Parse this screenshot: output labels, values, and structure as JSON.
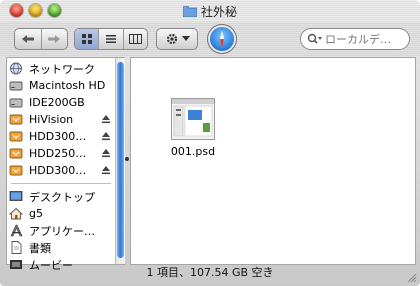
{
  "window": {
    "title": "社外秘",
    "title_icon": "folder-icon"
  },
  "toolbar": {
    "back_icon": "back-arrow-icon",
    "forward_icon": "forward-arrow-icon",
    "view_buttons": [
      "icon-view",
      "list-view",
      "column-view"
    ],
    "active_view": "icon-view",
    "action_icon": "gear-icon",
    "browser_icon": "safari-icon",
    "search_placeholder": "ローカルデ…"
  },
  "sidebar": {
    "devices": [
      {
        "label": "ネットワーク",
        "icon": "network-globe-icon",
        "eject": false
      },
      {
        "label": "Macintosh HD",
        "icon": "hard-drive-icon",
        "eject": false
      },
      {
        "label": "IDE200GB",
        "icon": "hard-drive-icon",
        "eject": false
      },
      {
        "label": "HiVision",
        "icon": "firewire-drive-icon",
        "eject": true
      },
      {
        "label": "HDD300…",
        "icon": "firewire-drive-icon",
        "eject": true
      },
      {
        "label": "HDD250…",
        "icon": "firewire-drive-icon",
        "eject": true
      },
      {
        "label": "HDD300…",
        "icon": "firewire-drive-icon",
        "eject": true
      }
    ],
    "places": [
      {
        "label": "デスクトップ",
        "icon": "desktop-icon"
      },
      {
        "label": "g5",
        "icon": "home-icon"
      },
      {
        "label": "アプリケー…",
        "icon": "applications-icon"
      },
      {
        "label": "書類",
        "icon": "documents-icon"
      },
      {
        "label": "ムービー",
        "icon": "movies-icon"
      }
    ]
  },
  "content": {
    "files": [
      {
        "name": "001.psd",
        "icon": "psd-thumbnail-icon"
      }
    ]
  },
  "status": {
    "text": "1 項目、107.54 GB 空き"
  },
  "colors": {
    "selection_blue": "#2f79dd",
    "window_metal": "#d6d6d6"
  }
}
